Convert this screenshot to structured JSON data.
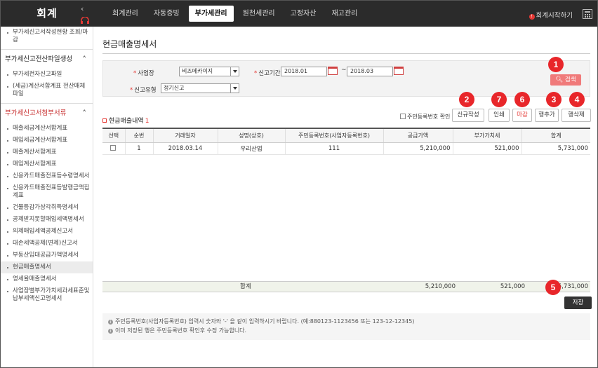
{
  "app": {
    "title": "회계"
  },
  "header": {
    "menu": [
      "회계관리",
      "자동증빙",
      "부가세관리",
      "원천세관리",
      "고정자산",
      "재고관리"
    ],
    "active_index": 2,
    "start_link": "회계시작하기"
  },
  "sidebar": {
    "items": [
      {
        "type": "item",
        "label": "부가세신고서작성현황 조회/마감"
      },
      {
        "type": "group",
        "label": "부가세신고전산파일생성"
      },
      {
        "type": "item",
        "label": "부가세전자신고파일"
      },
      {
        "type": "item",
        "label": "(세금)계산서합계표 전산매체파일"
      },
      {
        "type": "group",
        "label": "부가세신고서첨부서류",
        "highlight": true
      },
      {
        "type": "item",
        "label": "매출세금계산서합계표"
      },
      {
        "type": "item",
        "label": "매입세금계산서합계표"
      },
      {
        "type": "item",
        "label": "매출계산서합계표"
      },
      {
        "type": "item",
        "label": "매입계산서합계표"
      },
      {
        "type": "item",
        "label": "신용카드매출전표등수령명세서"
      },
      {
        "type": "item",
        "label": "신용카드매출전표등발행금액집계표"
      },
      {
        "type": "item",
        "label": "건물등감가상각취득명세서"
      },
      {
        "type": "item",
        "label": "공제받지못할매입세액명세서"
      },
      {
        "type": "item",
        "label": "의제매입세액공제신고서"
      },
      {
        "type": "item",
        "label": "대손세액공제(변제)신고서"
      },
      {
        "type": "item",
        "label": "부동산임대공급가액명세서"
      },
      {
        "type": "item",
        "label": "현금매출명세서",
        "selected": true
      },
      {
        "type": "item",
        "label": "영세율매출명세서"
      },
      {
        "type": "item",
        "label": "사업장별부가가치세과세표준및납부세액신고명세서"
      }
    ]
  },
  "page": {
    "title": "현금매출명세서"
  },
  "filter": {
    "business_label": "사업장",
    "business_value": "비즈메카이지",
    "period_label": "신고기간",
    "period_from": "2018.01",
    "period_dash": "~",
    "period_to": "2018.03",
    "type_label": "신고유형",
    "type_value": "정기신고",
    "search_label": "검색"
  },
  "section": {
    "title": "현금매출내역",
    "count": "1",
    "confirm_label": "주민등록번호 확인"
  },
  "buttons": {
    "new": "신규작성",
    "print": "인쇄",
    "close": "마감",
    "add_row": "행추가",
    "delete_row": "행삭제",
    "save": "저장"
  },
  "badges": {
    "search": "1",
    "new": "2",
    "add_row": "3",
    "delete_row": "4",
    "save": "5",
    "close": "6",
    "print": "7"
  },
  "table": {
    "headers": [
      "선택",
      "순번",
      "거래일자",
      "성명(상호)",
      "주민등록번호(사업자등록번호)",
      "공급가액",
      "부가가치세",
      "합계"
    ],
    "rows": [
      {
        "no": "1",
        "date": "2018.03.14",
        "name": "우리산업",
        "reg_no": "111",
        "supply": "5,210,000",
        "vat": "521,000",
        "total": "5,731,000"
      }
    ],
    "sum_label": "합계",
    "sum_supply": "5,210,000",
    "sum_vat": "521,000",
    "sum_total": "5,731,000"
  },
  "notes": [
    "주민등록번호(사업자등록번호) 입력시 숫자와 '-' 을 같이 입력하시기 바랍니다. (예:880123-1123456 또는 123-12-12345)",
    "이미 저장된 행은 주민등록번호 확인후 수정 가능합니다."
  ],
  "colors": {
    "accent": "#e8262a",
    "search_button": "#f07a7a",
    "topbar": "#2b2b2b"
  },
  "icons": {
    "collapse": "chevron-left-icon",
    "headset": "headset-icon",
    "calculator": "calculator-icon",
    "calendar": "calendar-icon",
    "info": "info-icon"
  }
}
